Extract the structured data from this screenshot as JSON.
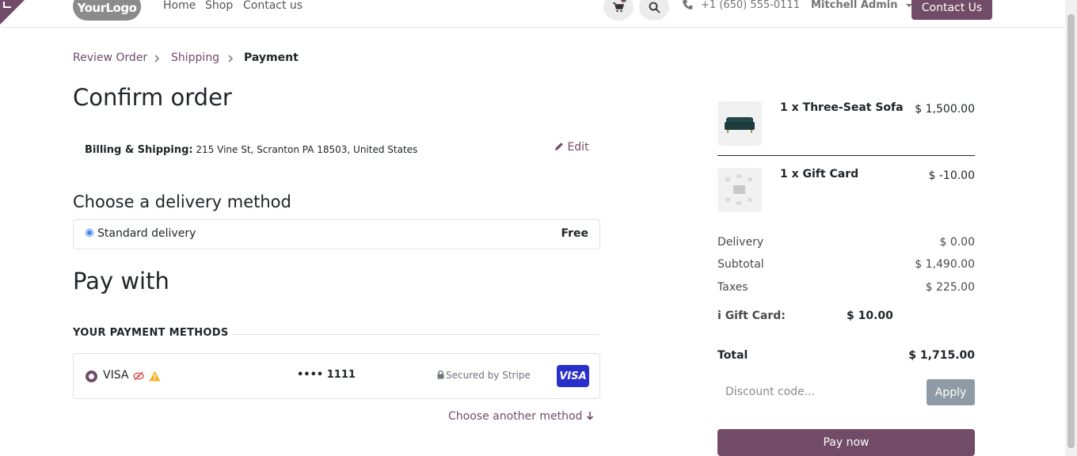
{
  "header": {
    "logo": "YourLogo",
    "nav": [
      "Home",
      "Shop",
      "Contact us"
    ],
    "phone": "+1 (650) 555-0111",
    "user": "Mitchell Admin",
    "contact_button": "Contact Us"
  },
  "breadcrumb": [
    "Review Order",
    "Shipping",
    "Payment"
  ],
  "page_title": "Confirm order",
  "billing": {
    "label": "Billing & Shipping:",
    "address": "215 Vine St, Scranton PA 18503, United States",
    "edit": "Edit"
  },
  "delivery": {
    "heading": "Choose a delivery method",
    "method": "Standard delivery",
    "price": "Free"
  },
  "payment": {
    "heading": "Pay with",
    "methods_heading": "YOUR PAYMENT METHODS",
    "card_name": "VISA",
    "card_number": "•••• 1111",
    "secured": "Secured by Stripe",
    "card_brand": "VISA",
    "choose_another": "Choose another method"
  },
  "summary": {
    "items": [
      {
        "qty_name": "1 x Three-Seat Sofa",
        "price": "$ 1,500.00"
      },
      {
        "qty_name": "1 x Gift Card",
        "price": "$ -10.00"
      }
    ],
    "delivery_label": "Delivery",
    "delivery_value": "$ 0.00",
    "subtotal_label": "Subtotal",
    "subtotal_value": "$ 1,490.00",
    "taxes_label": "Taxes",
    "taxes_value": "$ 225.00",
    "giftcard_label": "Gift Card:",
    "giftcard_value": "$ 10.00",
    "total_label": "Total",
    "total_value": "$ 1,715.00",
    "discount_placeholder": "Discount code...",
    "apply": "Apply",
    "pay_now": "Pay now"
  },
  "colors": {
    "brand": "#714B67",
    "visa": "#2a2fc9",
    "warning": "#f0b429",
    "danger": "#d9534f"
  }
}
